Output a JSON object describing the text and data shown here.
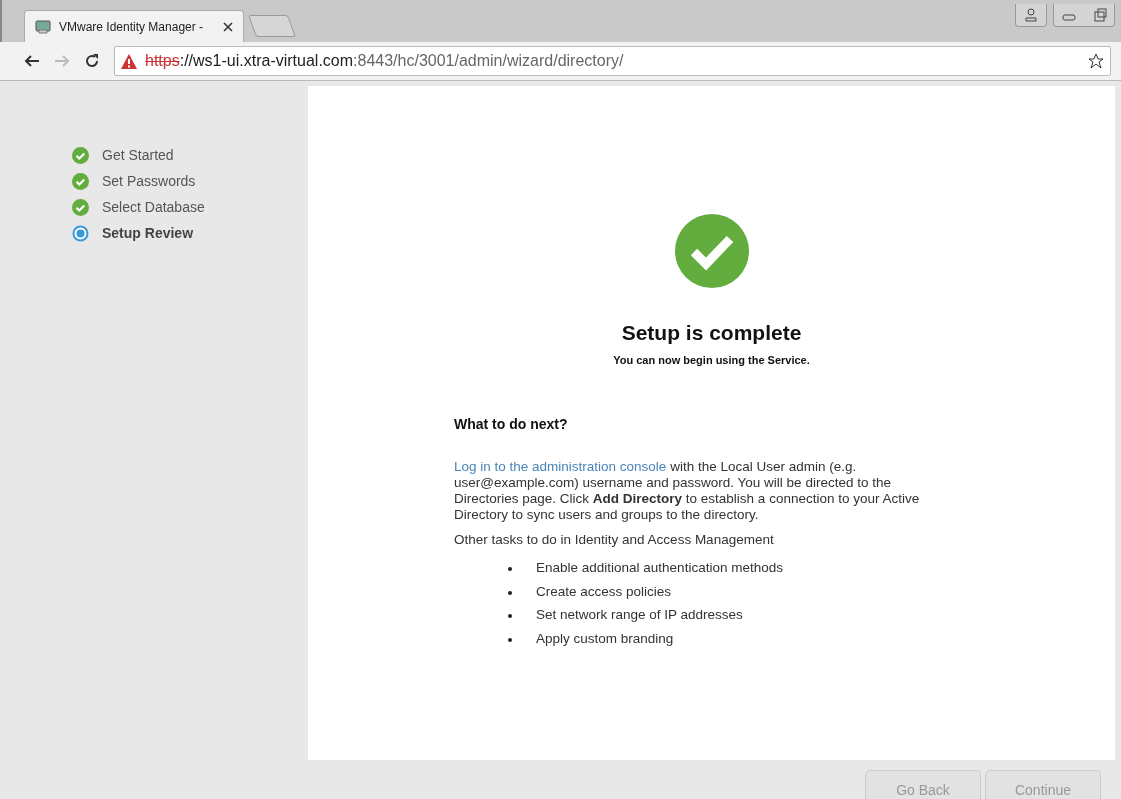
{
  "browser": {
    "tab_title": "VMware Identity Manager -",
    "url": {
      "scheme": "https",
      "host": "://ws1-ui.xtra-virtual.com",
      "path": ":8443/hc/3001/admin/wizard/directory/",
      "insecure": true
    }
  },
  "steps": [
    {
      "label": "Get Started",
      "completed": true,
      "selected": false
    },
    {
      "label": "Set Passwords",
      "completed": true,
      "selected": false
    },
    {
      "label": "Select Database",
      "completed": true,
      "selected": false
    },
    {
      "label": "Setup Review",
      "completed": false,
      "selected": true
    }
  ],
  "result": {
    "title": "Setup is complete",
    "subtitle": "You can now begin using the Service."
  },
  "next": {
    "heading": "What to do next?",
    "link": "Log in to the administration console",
    "text": " with the Local User admin (e.g. user@example.com) username and password. You will be directed to the Directories page. Click **Add Directory** to establish a connection to your Active Directory to sync users and groups to the directory.",
    "tasks_intro": "Other tasks to do in Identity and Access Management",
    "tasks": [
      "Enable additional authentication methods",
      "Create access policies",
      "Set network range of IP addresses",
      "Apply custom branding"
    ]
  },
  "buttons": [
    {
      "label": "Go Back",
      "disabled": true
    },
    {
      "label": "Continue",
      "disabled": true
    }
  ]
}
